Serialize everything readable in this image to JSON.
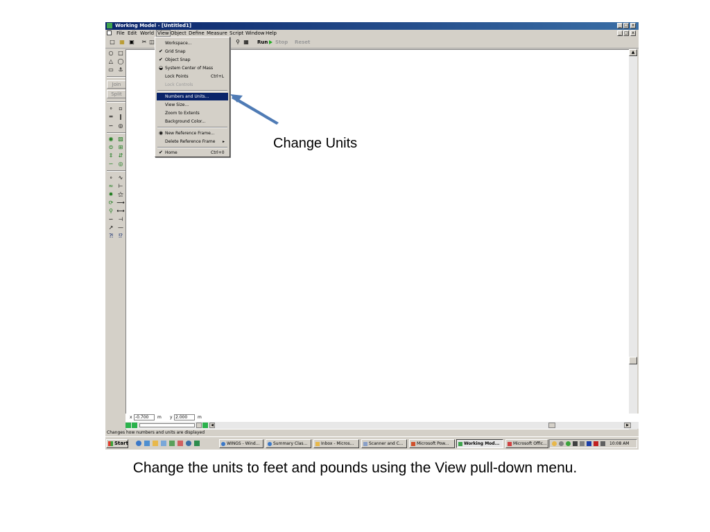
{
  "window": {
    "title": "Working Model - [Untitled1]",
    "controls": [
      "_",
      "□",
      "x"
    ]
  },
  "menubar": {
    "items": [
      "File",
      "Edit",
      "World",
      "View",
      "Object",
      "Define",
      "Measure",
      "Script",
      "Window",
      "Help"
    ]
  },
  "toolbar": {
    "run": "Run",
    "stop": "Stop",
    "reset": "Reset"
  },
  "palette": {
    "join": "Join",
    "split": "Split"
  },
  "view_menu": {
    "items": [
      {
        "label": "Workspace...",
        "shortcut": "",
        "check": ""
      },
      {
        "label": "Grid Snap",
        "shortcut": "",
        "check": "✔"
      },
      {
        "label": "Object Snap",
        "shortcut": "",
        "check": "✔"
      },
      {
        "label": "System Center of Mass",
        "shortcut": "",
        "check": "◒"
      },
      {
        "label": "Lock Points",
        "shortcut": "Ctrl+L",
        "check": ""
      },
      {
        "label": "Lock Controls",
        "shortcut": "",
        "check": ""
      },
      {
        "label": "Numbers and Units...",
        "shortcut": "",
        "check": ""
      },
      {
        "label": "View Size...",
        "shortcut": "",
        "check": ""
      },
      {
        "label": "Zoom to Extents",
        "shortcut": "",
        "check": ""
      },
      {
        "label": "Background Color...",
        "shortcut": "",
        "check": ""
      },
      {
        "label": "New Reference Frame...",
        "shortcut": "",
        "check": "◉"
      },
      {
        "label": "Delete Reference Frame",
        "shortcut": "▸",
        "check": ""
      },
      {
        "label": "Home",
        "shortcut": "Ctrl+0",
        "check": "✔"
      }
    ]
  },
  "coords": {
    "x_label": "x",
    "x_value": "-0.700",
    "x_unit": "m",
    "y_label": "y",
    "y_value": "2.000",
    "y_unit": "m"
  },
  "statusbar": {
    "text": "Changes how numbers and units are displayed"
  },
  "taskbar": {
    "start": "Start",
    "tasks": [
      "WINGS - Wind...",
      "Summary Clas...",
      "Inbox - Micros...",
      "Scanner and C...",
      "Microsoft Pow...",
      "Working Mod...",
      "Microsoft Offic..."
    ],
    "clock": "10:08 AM"
  },
  "annotation": {
    "label": "Change Units",
    "caption": "Change the units to feet and pounds using the View pull-down menu."
  },
  "colors": {
    "titlebar": "#0a246a",
    "highlight": "#0a246a",
    "arrow": "#4f7bb5",
    "chrome": "#d4d0c8"
  }
}
